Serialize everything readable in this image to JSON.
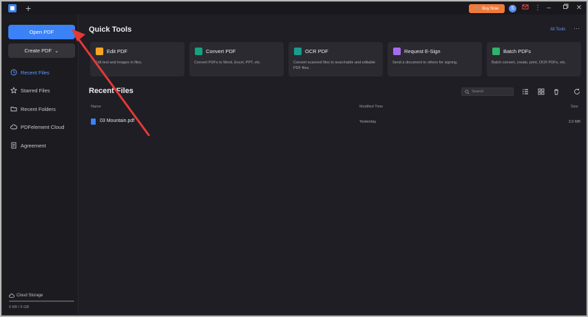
{
  "titlebar": {
    "new_tab": "+",
    "buy_now": "Buy Now",
    "avatar": "S",
    "window_controls": [
      "minimize-icon",
      "restore-icon",
      "close-icon"
    ]
  },
  "sidebar": {
    "open_pdf": "Open PDF",
    "create_pdf": "Create PDF",
    "items": [
      {
        "label": "Recent Files",
        "icon": "clock-icon",
        "active": true
      },
      {
        "label": "Starred Files",
        "icon": "star-icon"
      },
      {
        "label": "Recent Folders",
        "icon": "folder-icon"
      },
      {
        "label": "PDFelement Cloud",
        "icon": "cloud-icon"
      },
      {
        "label": "Agreement",
        "icon": "document-icon"
      }
    ],
    "storage_label": "Cloud Storage",
    "storage_text": "0 KB / 5 GB"
  },
  "quick_tools": {
    "title": "Quick Tools",
    "all_tools": "All Tools",
    "cards": [
      {
        "title": "Edit PDF",
        "desc": "Edit text and images in files.",
        "color": "#f5a623"
      },
      {
        "title": "Convert PDF",
        "desc": "Convert PDFs to Word, Excel, PPT, etc.",
        "color": "#15a37f"
      },
      {
        "title": "OCR PDF",
        "desc": "Convert scanned files to searchable and editable PDF files.",
        "color": "#1a9c8c"
      },
      {
        "title": "Request E-Sign",
        "desc": "Send a document to others for signing.",
        "color": "#a56cf0"
      },
      {
        "title": "Batch PDFs",
        "desc": "Batch convert, create, print, OCR PDFs, etc.",
        "color": "#2fb36b"
      }
    ]
  },
  "recent": {
    "title": "Recent Files",
    "search_placeholder": "Search",
    "columns": {
      "name": "Name",
      "modified": "Modified Time",
      "size": "Size"
    },
    "files": [
      {
        "name": "03 Mountain.pdf",
        "modified": "Yesterday",
        "size": "3.9 MB"
      }
    ]
  },
  "colors": {
    "accent": "#3b82f6",
    "annotation_arrow": "#e53935"
  }
}
